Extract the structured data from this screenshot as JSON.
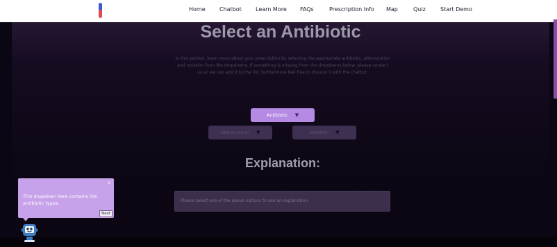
{
  "nav": {
    "items": [
      "Home",
      "Chatbot",
      "Learn More",
      "FAQs",
      "Prescription Info",
      "Map",
      "Quiz",
      "Start Demo"
    ],
    "logo_icon": "pill-capsule-icon"
  },
  "main": {
    "title": "Select an Antibiotic",
    "intro": "In this section, learn more about your prescription by selecting the appropriate antibiotic, abbreviation and notation from the dropdowns. If something is missing from the dropdowns below, please contact us so we can add it to the list, furthermore feel free to discuss it with the chatbot.",
    "dropdowns": {
      "antibiotic": "Antibiotic",
      "abbreviation": "Abbreviation",
      "notation": "Notation"
    },
    "explanation_title": "Explanation:",
    "explanation_placeholder": "Please select one of the above options to see an explanation."
  },
  "tooltip": {
    "close": "x",
    "text": "This dropdown here contains the antibiotic types.",
    "next": "Next"
  },
  "colors": {
    "accent": "#b48ae2",
    "tooltip_bg": "#c7a2ea",
    "panel": "#3b2f4d",
    "background": "#0a0613"
  }
}
